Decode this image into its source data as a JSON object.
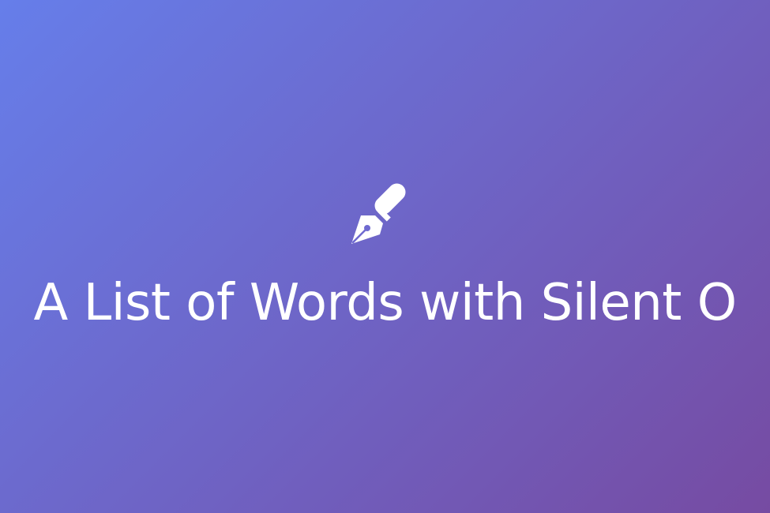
{
  "hero": {
    "title": "A List of Words with Silent O",
    "icon": "fountain-pen-icon",
    "colors": {
      "gradient_start": "#667eea",
      "gradient_end": "#764ba2",
      "text": "#ffffff"
    }
  }
}
